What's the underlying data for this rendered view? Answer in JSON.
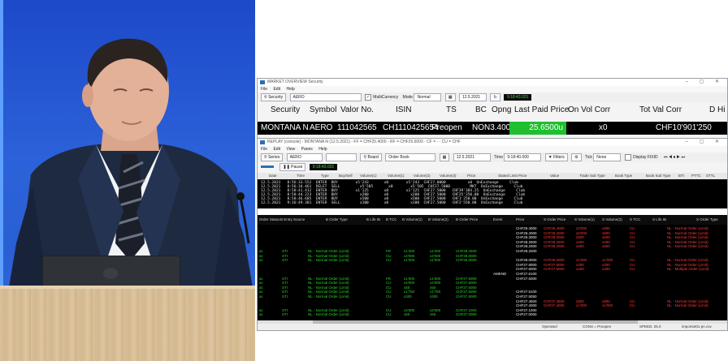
{
  "window1": {
    "title": "MARKET OVERVIEW Security",
    "menu": [
      "File",
      "Edit",
      "Help"
    ],
    "toolbar": {
      "security_button": "Security",
      "security_value": "AERO",
      "multicurrency_label": "MultiCurrency",
      "mode_label": "Mode",
      "mode_value": "Normal",
      "date_value": "12.5.2021",
      "clock": "9:18:43.031"
    },
    "columns": [
      "Security",
      "Symbol",
      "Valor No.",
      "ISIN",
      "TS",
      "BC",
      "Opng",
      "Last Paid Price",
      "On Vol Corr",
      "Tot Val Corr",
      "D Hi"
    ],
    "row": {
      "security": "MONTANA N",
      "symbol": "AERO",
      "valor": "111042565",
      "isin": "CH1110425654",
      "ts": "Preopen",
      "bc_opng": "NON3.4000",
      "last_paid": "25.6500u",
      "on_vol": "x0",
      "tot_val": "CHF10'901'250"
    }
  },
  "window2": {
    "title": "REPLAY (console) - MONTANA N (12.5.2021) - FF = CHF25.4000 - RF = CHF25.6000 - CF = - - CU = CHF",
    "menu": [
      "File",
      "Edit",
      "View",
      "Panes",
      "Help"
    ],
    "toolbar1": {
      "series_button": "Series",
      "series_value": "AERO",
      "board_button": "Board",
      "board_value": "Order Book",
      "date_value": "12.5.2021",
      "time_label": "Time",
      "time_value": "9:18:40.000",
      "filters_button": "Filters",
      "tick_label": "Tick",
      "tick_value": "None",
      "display_label": "Display FIXID"
    },
    "toolbar2": {
      "pause_button": "Pause",
      "clock": "9:18:43.031"
    },
    "trade_columns": [
      "Date",
      "Time",
      "Type",
      "Buy/Sell",
      "Volume(1)",
      "Volume(1)",
      "Volume(2)",
      "Volume(3)",
      "Price",
      "Stated Limit Price",
      "Value",
      "Trade Sub Type",
      "Book Type",
      "Book Sub Type",
      "BTI",
      "PTTC",
      "STTL"
    ],
    "trades": [
      "12.5.2021   8:56:33.552  ENTER  BUY        x5'243       x0        x5'243  CHF27.0000          x0  OnExchange     Club",
      "12.5.2021   8:56:34.461  DELET  SELL         x5'505       x0        x5'505  CHF27.5000         MKT  OnExchange     Club",
      "12.5.2021   8:58:41.412  ENTER  BUY        x1'125       x0        x1'125  CHF27.5000   CHF39'384.25  OnExchange     Club",
      "12.5.2021   8:58:44.223  ENTER  BUY          x200       x0          x200  CHF27.5000   CHF25'250.00  OnExchange     Club",
      "12.5.2021   8:58:46.685  ENTER  BUY          x500       x0          x500  CHF27.5000   CHF1'250.00  OnExchange     Club",
      "12.5.2021   9:16:49.381  ENTER  SELL         x100       x0          x100  CHF27.5000   CHF2'550.00  OnExchange     Club"
    ],
    "book_columns": [
      "Order Status",
      "B Entry Source",
      "B Order Type",
      "B Life IB",
      "B TCC",
      "B Volume(1)",
      "B Volume(2)",
      "B Order Price",
      "Event",
      "Price",
      "S Order Price",
      "S Volume(1)",
      "S Volume(2)",
      "S TCC",
      "S Life IB",
      "S Order Type"
    ],
    "book_rows": [
      {
        "bs": "",
        "src": "",
        "ot": "",
        "life": "",
        "tcc": "",
        "v1": "",
        "v2": "",
        "bp": "",
        "ev": "",
        "price": "CHF29.4000",
        "sp": "CHF29.4000",
        "sv1": "x3'000",
        "sv2": "x800",
        "stcc": "CU",
        "slife": "",
        "sot": "NL - Normal Order (Limit)"
      },
      {
        "bs": "",
        "src": "",
        "ot": "",
        "life": "",
        "tcc": "",
        "v1": "",
        "v2": "",
        "bp": "",
        "ev": "",
        "price": "CHF28.4000",
        "sp": "CHF28.4000",
        "sv1": "x6'000",
        "sv2": "x800",
        "stcc": "CU",
        "slife": "",
        "sot": "NL - Normal Order (Limit)"
      },
      {
        "bs": "",
        "src": "",
        "ot": "",
        "life": "",
        "tcc": "",
        "v1": "",
        "v2": "",
        "bp": "",
        "ev": "",
        "price": "CHF28.3000",
        "sp": "CHF28.3000",
        "sv1": "x500",
        "sv2": "x500",
        "stcc": "CU",
        "slife": "",
        "sot": "NL - Normal Order (Limit)"
      },
      {
        "bs": "",
        "src": "",
        "ot": "",
        "life": "",
        "tcc": "",
        "v1": "",
        "v2": "",
        "bp": "",
        "ev": "",
        "price": "CHF28.2500",
        "sp": "CHF28.2500",
        "sv1": "x400",
        "sv2": "x400",
        "stcc": "CU",
        "slife": "",
        "sot": "NL - Normal Order (Limit)"
      },
      {
        "bs": "",
        "src": "",
        "ot": "",
        "life": "",
        "tcc": "",
        "v1": "",
        "v2": "",
        "bp": "",
        "ev": "",
        "price": "CHF28.2000",
        "sp": "CHF28.2000",
        "sv1": "x500",
        "sv2": "x500",
        "stcc": "CU",
        "slife": "",
        "sot": "NL - Normal Order (Limit)"
      },
      {
        "bs": "ac",
        "src": "STI",
        "ot": "NL - Normal Order (Limit)",
        "life": "",
        "tcc": "FR",
        "v1": "x1'200",
        "v2": "x1'200",
        "bp": "CHF28.2500",
        "ev": "",
        "price": "CHF28.2000",
        "sp": "",
        "sv1": "",
        "sv2": "",
        "stcc": "",
        "slife": "",
        "sot": ""
      },
      {
        "bs": "ac",
        "src": "STI",
        "ot": "NL - Normal Order (Limit)",
        "life": "",
        "tcc": "CU",
        "v1": "x4'000",
        "v2": "x4'000",
        "bp": "CHF28.0000",
        "ev": "",
        "price": "",
        "sp": "",
        "sv1": "",
        "sv2": "",
        "stcc": "",
        "slife": "",
        "sot": ""
      },
      {
        "bs": "ac",
        "src": "STI",
        "ot": "NL - Normal Order (Limit)",
        "life": "",
        "tcc": "CU",
        "v1": "x1'000",
        "v2": "x1'000",
        "bp": "CHF28.0000",
        "ev": "",
        "price": "CHF28.0000",
        "sp": "CHF28.0000",
        "sv1": "x1'000",
        "sv2": "x1'000",
        "stcc": "CU",
        "slife": "",
        "sot": "NL - Normal Order (Limit)"
      },
      {
        "bs": "",
        "src": "",
        "ot": "",
        "life": "",
        "tcc": "",
        "v1": "",
        "v2": "",
        "bp": "",
        "ev": "",
        "price": "CHF27.8000",
        "sp": "CHF27.8000",
        "sv1": "x300",
        "sv2": "x300",
        "stcc": "CU",
        "slife": "",
        "sot": "NL - Normal Order (Limit)"
      },
      {
        "bs": "",
        "src": "",
        "ot": "",
        "life": "",
        "tcc": "",
        "v1": "",
        "v2": "",
        "bp": "",
        "ev": "",
        "price": "CHF27.6000",
        "sp": "CHF27.6000",
        "sv1": "x400",
        "sv2": "x400",
        "stcc": "CU",
        "slife": "",
        "sot": "NL - Multiple Order (Limit)"
      },
      {
        "bs": "",
        "src": "",
        "ot": "",
        "life": "",
        "tcc": "",
        "v1": "",
        "v2": "",
        "bp": "",
        "ev": "AMEND",
        "price": "CHF27.6100",
        "sp": "",
        "sv1": "",
        "sv2": "",
        "stcc": "",
        "slife": "",
        "sot": ""
      },
      {
        "bs": "ac",
        "src": "STI",
        "ot": "NL - Normal Order (Limit)",
        "life": "",
        "tcc": "FR",
        "v1": "x1'000",
        "v2": "x1'000",
        "bp": "CHF27.6000",
        "ev": "",
        "price": "CHF27.6000",
        "sp": "",
        "sv1": "",
        "sv2": "",
        "stcc": "",
        "slife": "",
        "sot": ""
      },
      {
        "bs": "ac",
        "src": "STI",
        "ot": "NL - Normal Order (Limit)",
        "life": "",
        "tcc": "CU",
        "v1": "x4'000",
        "v2": "x4'000",
        "bp": "CHF27.6000",
        "ev": "",
        "price": "",
        "sp": "",
        "sv1": "",
        "sv2": "",
        "stcc": "",
        "slife": "",
        "sot": ""
      },
      {
        "bs": "ac",
        "src": "STI",
        "ot": "NL - Normal Order (Limit)",
        "life": "",
        "tcc": "CU",
        "v1": "x50",
        "v2": "x50",
        "bp": "CHF27.5000",
        "ev": "",
        "price": "",
        "sp": "",
        "sv1": "",
        "sv2": "",
        "stcc": "",
        "slife": "",
        "sot": ""
      },
      {
        "bs": "ac",
        "src": "STI",
        "ot": "NL - Normal Order (Limit)",
        "life": "",
        "tcc": "CU",
        "v1": "x1'750",
        "v2": "x1'750",
        "bp": "CHF27.5000",
        "ev": "",
        "price": "CHF27.5100",
        "sp": "",
        "sv1": "",
        "sv2": "",
        "stcc": "",
        "slife": "",
        "sot": ""
      },
      {
        "bs": "ac",
        "src": "STI",
        "ot": "NL - Normal Order (Limit)",
        "life": "",
        "tcc": "CU",
        "v1": "x300",
        "v2": "x300",
        "bp": "CHF27.5000",
        "ev": "",
        "price": "CHF27.5050",
        "sp": "",
        "sv1": "",
        "sv2": "",
        "stcc": "",
        "slife": "",
        "sot": ""
      },
      {
        "bs": "",
        "src": "",
        "ot": "",
        "life": "",
        "tcc": "",
        "v1": "",
        "v2": "",
        "bp": "",
        "ev": "",
        "price": "CHF27.4500",
        "sp": "CHF27.4500",
        "sv1": "x800",
        "sv2": "x800",
        "stcc": "CU",
        "slife": "",
        "sot": "NL - Normal Order (Limit)"
      },
      {
        "bs": "",
        "src": "",
        "ot": "",
        "life": "",
        "tcc": "",
        "v1": "",
        "v2": "",
        "bp": "",
        "ev": "",
        "price": "CHF27.4000",
        "sp": "CHF27.4000",
        "sv1": "x1'000",
        "sv2": "x1'000",
        "stcc": "CU",
        "slife": "",
        "sot": "NL - Normal Order (Limit)"
      },
      {
        "bs": "ac",
        "src": "STI",
        "ot": "NL - Normal Order (Limit)",
        "life": "",
        "tcc": "CU",
        "v1": "x2'000",
        "v2": "x2'000",
        "bp": "CHF27.1000",
        "ev": "",
        "price": "CHF27.1000",
        "sp": "",
        "sv1": "",
        "sv2": "",
        "stcc": "",
        "slife": "",
        "sot": ""
      },
      {
        "bs": "ac",
        "src": "STI",
        "ot": "NL - Normal Order (Limit)",
        "life": "",
        "tcc": "CU",
        "v1": "x50",
        "v2": "x50",
        "bp": "CHF27.0000",
        "ev": "",
        "price": "CHF27.0000",
        "sp": "",
        "sv1": "",
        "sv2": "",
        "stcc": "",
        "slife": "",
        "sot": ""
      }
    ],
    "status": {
      "left": "Operated",
      "mid": "CONS = Preopen",
      "speed": "SPEED: 25.0",
      "file": "importsett1-pn.csv"
    }
  },
  "colors": {
    "buy": "#29d629",
    "sell": "#ff3b3b",
    "highlight": "#1fbf2f"
  }
}
